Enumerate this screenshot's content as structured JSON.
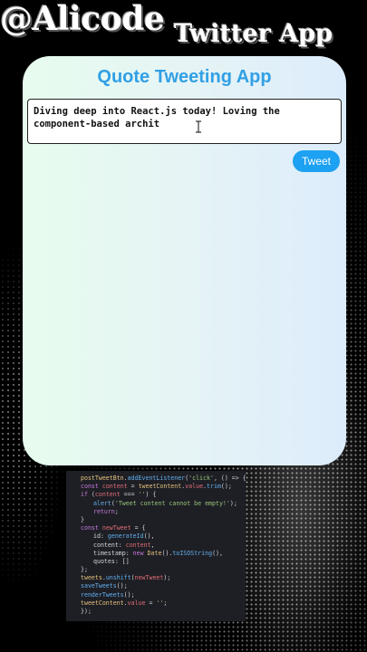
{
  "overlay": {
    "brand": "@Alicode",
    "app_label": "Twitter App"
  },
  "app": {
    "title": "Quote Tweeting App",
    "input_value": "Diving deep into React.js today! Loving the component-based archit",
    "tweet_button": "Tweet"
  },
  "code": {
    "lines": [
      "postTweetBtn.addEventListener('click', () => {",
      "const content = tweetContent.value.trim();",
      "if (content === '') {",
      "    alert('Tweet content cannot be empty!');",
      "    return;",
      "}",
      "const newTweet = {",
      "    id: generateId(),",
      "    content: content,",
      "    timestamp: new Date().toISOString(),",
      "    quotes: []",
      "};",
      "tweets.unshift(newTweet);",
      "saveTweets();",
      "renderTweets();",
      "tweetContent.value = '';",
      "});"
    ]
  },
  "colors": {
    "title_blue": "#31a0e6",
    "button_blue": "#1da1f2"
  }
}
